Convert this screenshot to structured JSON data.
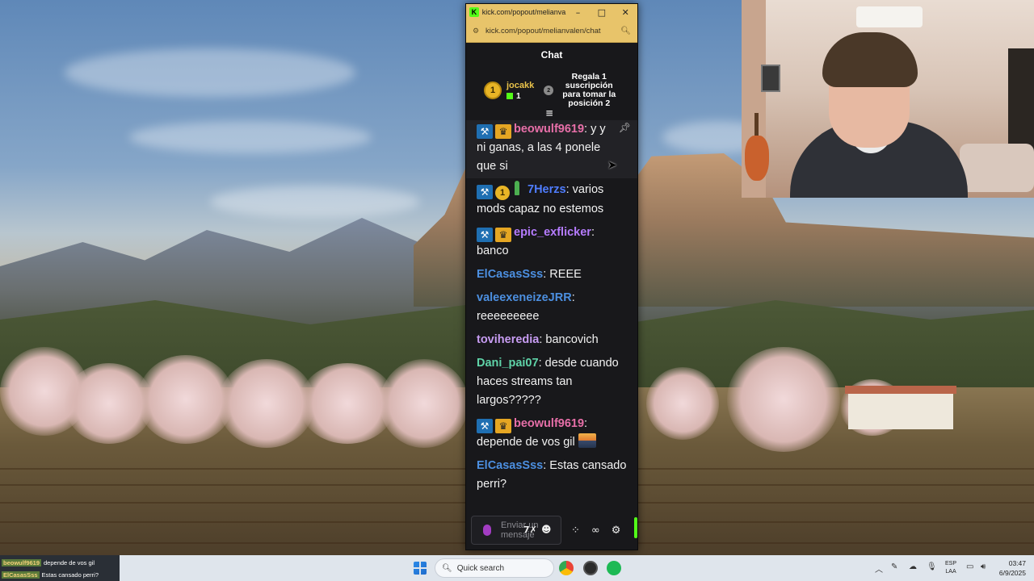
{
  "browser": {
    "tab_title": "kick.com/popout/melianval...",
    "url": "kick.com/popout/melianvalen/chat",
    "minimize": "–",
    "maximize": "□",
    "close": "✕"
  },
  "chat": {
    "header": "Chat",
    "leaderboard": {
      "rank1": "1",
      "rank1_user": "jocakk",
      "rank1_count": "1",
      "rank2": "2",
      "cta": "Regala 1 suscripción para tomar la posición 2"
    },
    "messages": [
      {
        "user": "beowulf9619",
        "user_color": "#e76fa8",
        "text": "y y ni ganas, a las 4 ponele que si"
      },
      {
        "user": "7Herzs",
        "user_color": "#4f7dff",
        "text": "varios mods capaz no estemos"
      },
      {
        "user": "epic_exflicker",
        "user_color": "#b67cff",
        "text": "banco"
      },
      {
        "user": "ElCasasSss",
        "user_color": "#4c8fe0",
        "text": "REEE"
      },
      {
        "user": "valeexeneizeJRR",
        "user_color": "#4c8fe0",
        "text": "reeeeeeeee"
      },
      {
        "user": "toviheredia",
        "user_color": "#c79cf2",
        "text": "bancovich"
      },
      {
        "user": "Dani_pai07",
        "user_color": "#5fd3a8",
        "text": "desde cuando haces streams tan largos?????"
      },
      {
        "user": "beowulf9619",
        "user_color": "#e76fa8",
        "text": "depende de vos gil"
      },
      {
        "user": "ElCasasSss",
        "user_color": "#4c8fe0",
        "text": "Estas cansado perri?"
      }
    ],
    "input_placeholder": "Enviar un mensaje"
  },
  "taskbar": {
    "search_placeholder": "Quick search",
    "time": "03:47",
    "date": "6/9/2025",
    "lang_top": "ESP",
    "lang_bottom": "LAA",
    "notification": [
      {
        "user": "beowulf9619",
        "text": "depende de vos gil"
      },
      {
        "user": "ElCasasSss",
        "text": "Estas cansado perri?"
      }
    ]
  },
  "colors": {
    "kick_green": "#53fc18",
    "chat_bg": "#18181b",
    "browser_frame": "#e8c46a"
  }
}
